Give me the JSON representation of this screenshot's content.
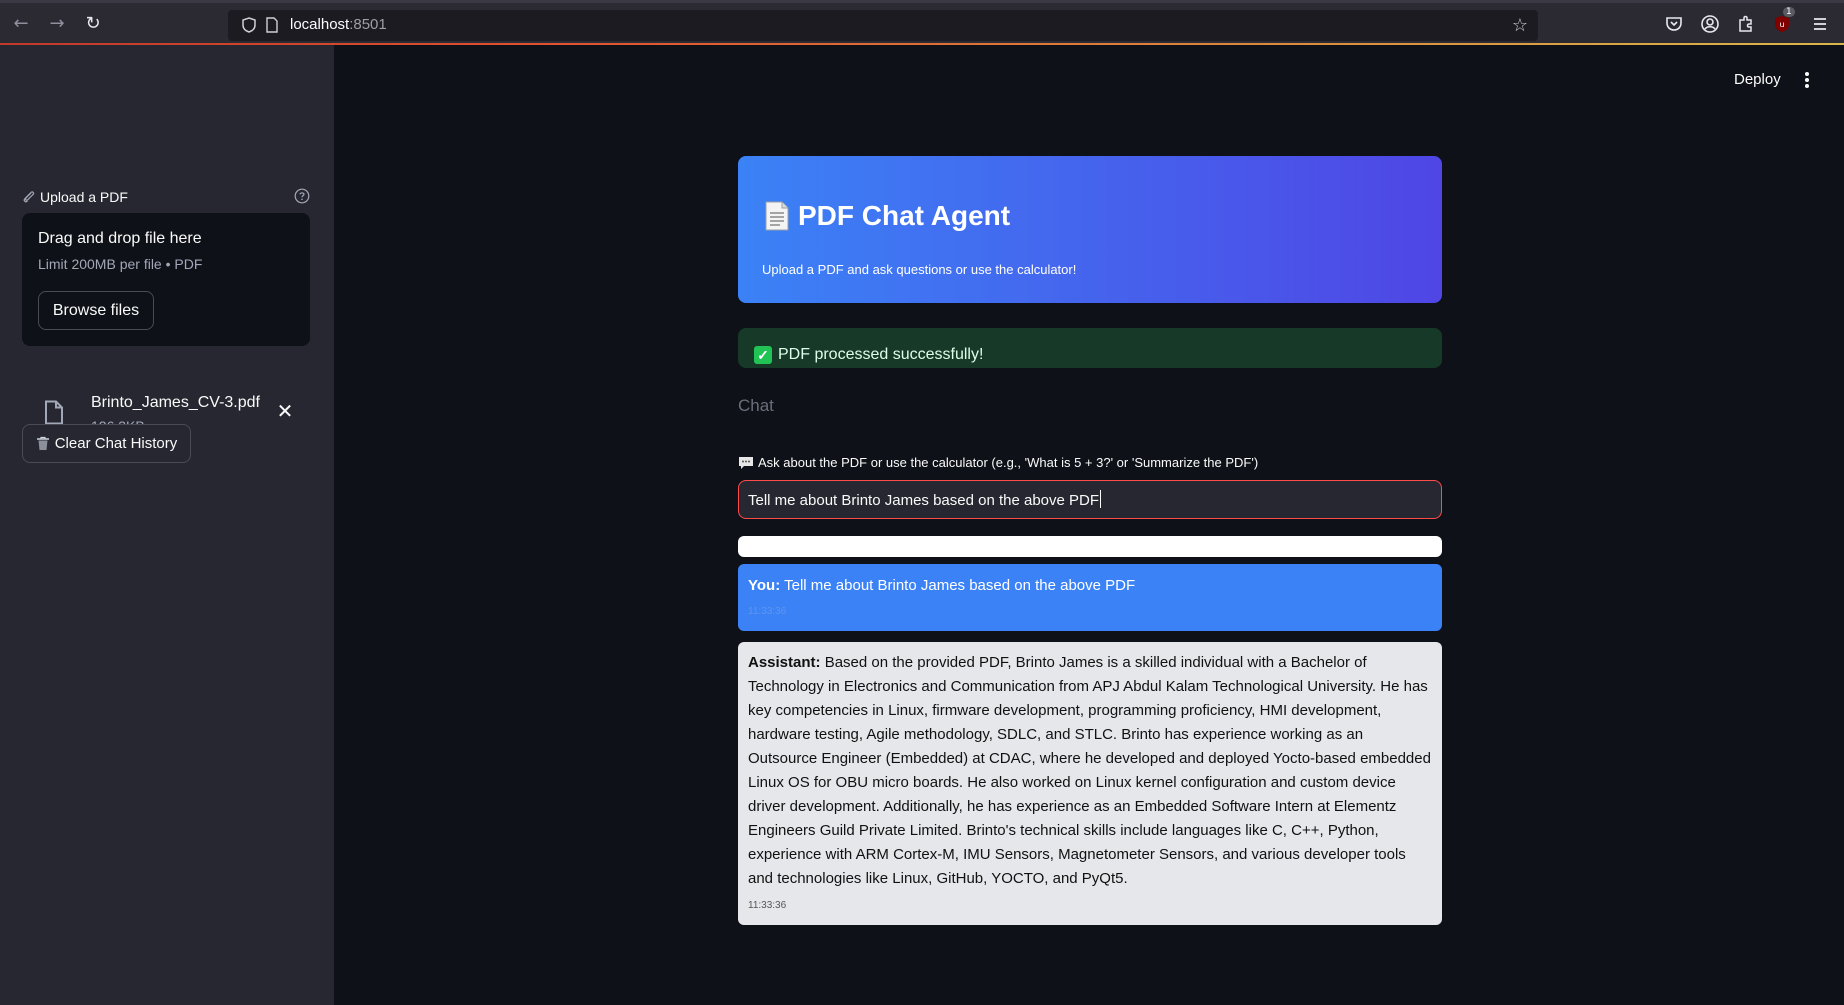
{
  "browser": {
    "url_host": "localhost",
    "url_port": ":8501",
    "extension_badge": "1"
  },
  "sidebar": {
    "upload_label": "Upload a PDF",
    "dropzone_title": "Drag and drop file here",
    "dropzone_limit": "Limit 200MB per file • PDF",
    "browse_label": "Browse files",
    "file": {
      "name": "Brinto_James_CV-3.pdf",
      "size": "126.3KB"
    },
    "clear_label": "Clear Chat History"
  },
  "toolbar": {
    "deploy_label": "Deploy"
  },
  "header": {
    "title": "PDF Chat Agent",
    "subtitle": "Upload a PDF and ask questions or use the calculator!"
  },
  "status": {
    "success_text": "PDF processed successfully!"
  },
  "chat": {
    "heading": "Chat",
    "input_label": "Ask about the PDF or use the calculator (e.g., 'What is 5 + 3?' or 'Summarize the PDF')",
    "input_value": "Tell me about Brinto James based on the above PDF",
    "messages": [
      {
        "role_label": "You:",
        "text": "Tell me about Brinto James based on the above PDF",
        "time": "11:33:36"
      },
      {
        "role_label": "Assistant:",
        "text": "Based on the provided PDF, Brinto James is a skilled individual with a Bachelor of Technology in Electronics and Communication from APJ Abdul Kalam Technological University. He has key competencies in Linux, firmware development, programming proficiency, HMI development, hardware testing, Agile methodology, SDLC, and STLC. Brinto has experience working as an Outsource Engineer (Embedded) at CDAC, where he developed and deployed Yocto-based embedded Linux OS for OBU micro boards. He also worked on Linux kernel configuration and custom device driver development. Additionally, he has experience as an Embedded Software Intern at Elementz Engineers Guild Private Limited. Brinto's technical skills include languages like C, C++, Python, experience with ARM Cortex-M, IMU Sensors, Magnetometer Sensors, and various developer tools and technologies like Linux, GitHub, YOCTO, and PyQt5.",
        "time": "11:33:36"
      }
    ]
  },
  "icons": [
    "back-icon",
    "forward-icon",
    "reload-icon",
    "shield-icon",
    "page-icon",
    "bookmark-star-icon",
    "pocket-icon",
    "account-icon",
    "extensions-icon",
    "ublock-icon",
    "menu-icon",
    "paperclip-icon",
    "help-icon",
    "file-icon",
    "close-icon",
    "trash-icon",
    "kebab-menu-icon",
    "document-icon",
    "check-icon",
    "speech-bubble-icon"
  ],
  "colors": {
    "app_bg": "#0e1117",
    "sidebar_bg": "#262730",
    "header_gradient_start": "#3b82f6",
    "header_gradient_end": "#4f46e5",
    "success_bg": "#173928",
    "input_border": "#ff4b4b",
    "user_bubble": "#3b82f6",
    "assistant_bubble": "#e5e7eb"
  }
}
